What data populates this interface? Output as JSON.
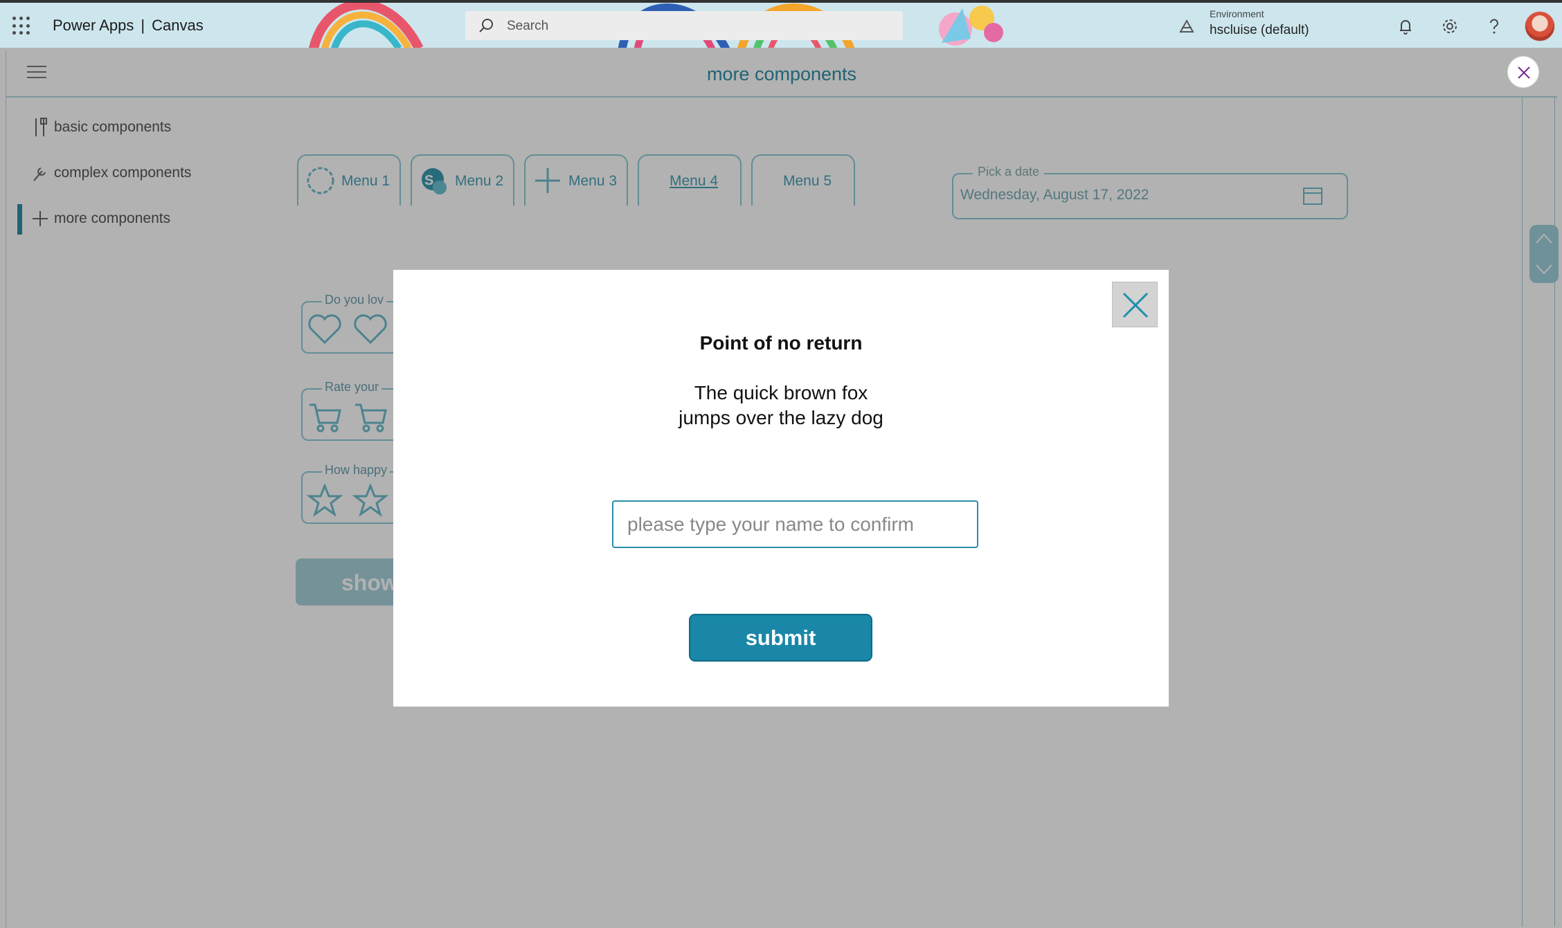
{
  "topbar": {
    "brand": "Power Apps",
    "separator": "|",
    "product": "Canvas",
    "search_placeholder": "Search",
    "environment_label": "Environment",
    "environment_value": "hscluise (default)"
  },
  "app": {
    "title": "more components",
    "nav": [
      {
        "label": "basic components",
        "icon": "tools-icon"
      },
      {
        "label": "complex components",
        "icon": "wrench-icon"
      },
      {
        "label": "more components",
        "icon": "plus-icon"
      }
    ],
    "menus": [
      "Menu 1",
      "Menu 2",
      "Menu 3",
      "Menu 4",
      "Menu 5"
    ],
    "datepicker": {
      "label": "Pick a date",
      "value": "Wednesday, August 17, 2022"
    },
    "ratings": [
      {
        "label": "Do you lov",
        "icon": "heart-icon"
      },
      {
        "label": "Rate your",
        "icon": "cart-icon"
      },
      {
        "label": "How happy",
        "icon": "star-icon"
      }
    ],
    "show_button": "show"
  },
  "dialog": {
    "title": "Point of no return",
    "body_line1": "The quick brown fox",
    "body_line2": "jumps over the lazy dog",
    "input_placeholder": "please type your name to confirm",
    "input_value": "",
    "submit_label": "submit"
  },
  "colors": {
    "accent": "#1a87a8",
    "topbar_bg": "#cde6ee",
    "overlay": "rgba(0,0,0,0.30)"
  }
}
